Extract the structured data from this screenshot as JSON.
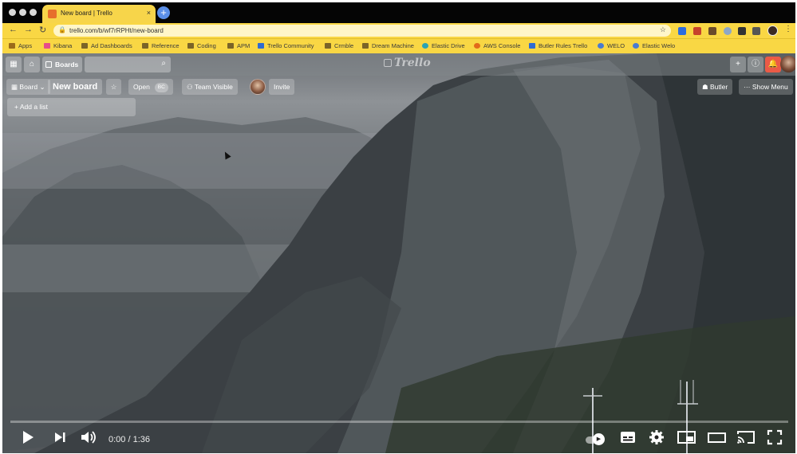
{
  "browser": {
    "tab_title": "New board | Trello",
    "tab_close": "×",
    "new_tab": "+",
    "url": "trello.com/b/wf7rRPHt/new-board",
    "bookmarks": [
      {
        "label": "Apps",
        "icon": "apps-grid-icon"
      },
      {
        "label": "Kibana",
        "icon": "kibana-icon"
      },
      {
        "label": "Ad Dashboards",
        "icon": "folder-icon"
      },
      {
        "label": "Reference",
        "icon": "folder-icon"
      },
      {
        "label": "Coding",
        "icon": "folder-icon"
      },
      {
        "label": "APM",
        "icon": "folder-icon"
      },
      {
        "label": "Trello Community",
        "icon": "trello-community-icon"
      },
      {
        "label": "Crmble",
        "icon": "folder-icon"
      },
      {
        "label": "Dream Machine",
        "icon": "folder-icon"
      },
      {
        "label": "Elastic Drive",
        "icon": "elastic-icon"
      },
      {
        "label": "AWS Console",
        "icon": "aws-icon"
      },
      {
        "label": "Butler Rules Trello",
        "icon": "trello-icon"
      },
      {
        "label": "WELO",
        "icon": "people-icon"
      },
      {
        "label": "Elastic Welo",
        "icon": "people-icon"
      }
    ],
    "accent": "#f9d744"
  },
  "trello": {
    "boards_label": "Boards",
    "logo": "Trello",
    "board": {
      "menu_label": "Board",
      "title": "New board",
      "visibility_label": "Open",
      "visibility_badge": "BC",
      "team_label": "Team Visible",
      "invite_label": "Invite",
      "butler_label": "Butler",
      "show_menu_label": "Show Menu",
      "add_list_label": "+ Add a list"
    },
    "notification_color": "#eb5a46"
  },
  "player": {
    "current_time": "0:00",
    "duration": "1:36",
    "time_display": "0:00 / 1:36",
    "progress": 0.0,
    "progress_color": "#ff0000"
  }
}
